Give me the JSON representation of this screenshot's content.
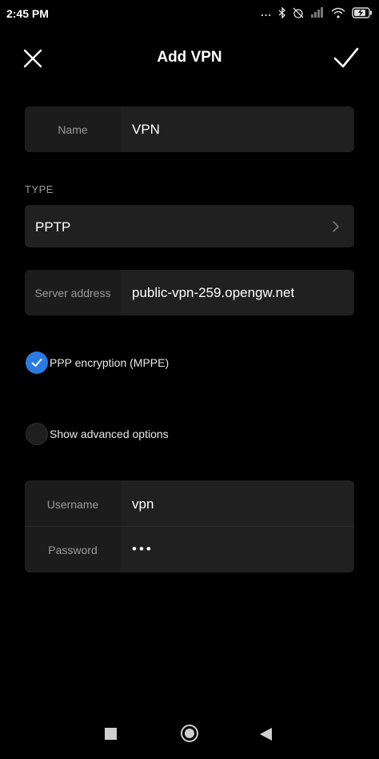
{
  "status_bar": {
    "time": "2:45 PM",
    "more_indicator": "...",
    "icons": [
      "bluetooth-icon",
      "alarm-off-icon",
      "signal-icon",
      "wifi-icon",
      "battery-charging-icon"
    ]
  },
  "header": {
    "title": "Add VPN",
    "close_icon": "close-icon",
    "confirm_icon": "check-icon"
  },
  "name_field": {
    "label": "Name",
    "value": "VPN"
  },
  "type_section": {
    "header": "TYPE",
    "value": "PPTP"
  },
  "server_field": {
    "label": "Server address",
    "value": "public-vpn-259.opengw.net"
  },
  "ppp_encryption": {
    "label": "PPP encryption (MPPE)",
    "checked": true
  },
  "advanced_options": {
    "label": "Show advanced options",
    "checked": false
  },
  "credentials": {
    "username": {
      "label": "Username",
      "value": "vpn"
    },
    "password": {
      "label": "Password",
      "value": "•••"
    }
  },
  "nav": {
    "icons": [
      "recents-icon",
      "home-icon",
      "back-icon"
    ]
  },
  "colors": {
    "background": "#000000",
    "card": "#202020",
    "accent": "#2a7ae2"
  }
}
